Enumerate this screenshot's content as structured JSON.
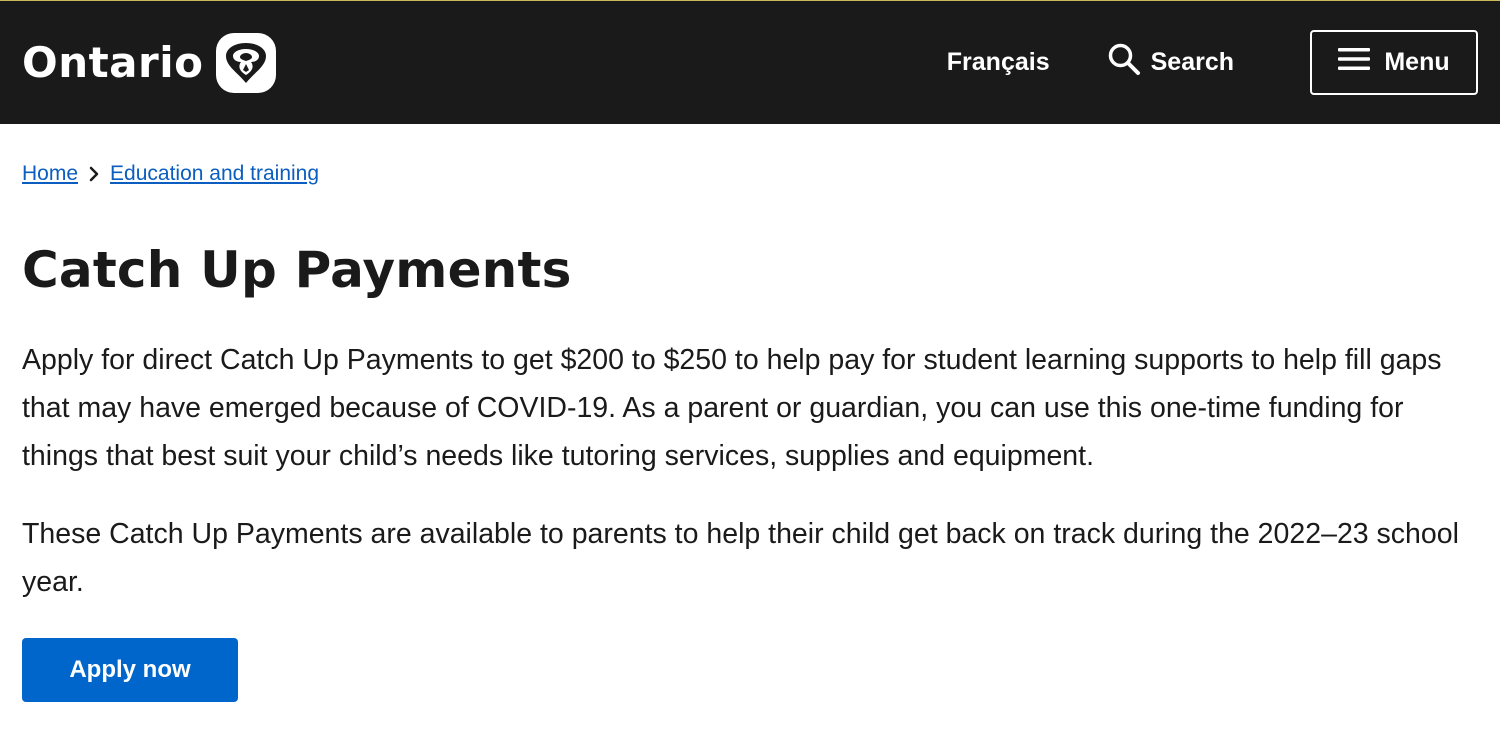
{
  "header": {
    "logo_text": "Ontario",
    "lang_link": "Français",
    "search_label": "Search",
    "menu_label": "Menu"
  },
  "breadcrumb": {
    "items": [
      {
        "label": "Home"
      },
      {
        "label": "Education and training"
      }
    ]
  },
  "page": {
    "title": "Catch Up Payments",
    "paragraph1": "Apply for direct Catch Up Payments to get $200 to $250 to help pay for student learning supports to help fill gaps that may have emerged because of COVID-19. As a parent or guardian, you can use this one-time funding for things that best suit your child’s needs like tutoring services, supplies and equipment.",
    "paragraph2": "These Catch Up Payments are available to parents to help their child get back on track during the 2022–23 school year.",
    "apply_button_label": "Apply now"
  },
  "colors": {
    "header_bg": "#1a1a1a",
    "link": "#0b5ebf",
    "primary_button": "#0066cc",
    "text": "#1a1a1a"
  },
  "icons": [
    "ontario-trillium-icon",
    "search-icon",
    "hamburger-menu-icon",
    "chevron-right-icon"
  ]
}
